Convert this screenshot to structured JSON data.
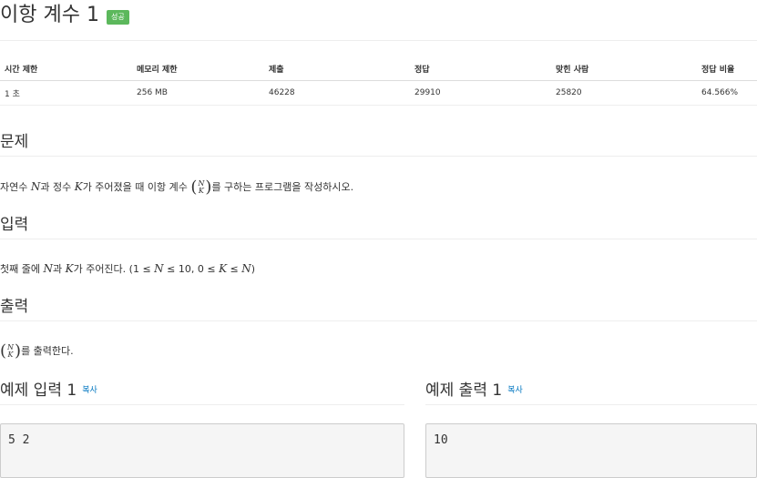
{
  "problem": {
    "title": "이항 계수 1",
    "status_badge": "성공"
  },
  "info_table": {
    "headers": [
      "시간 제한",
      "메모리 제한",
      "제출",
      "정답",
      "맞힌 사람",
      "정답 비율"
    ],
    "row": [
      "1 초",
      "256 MB",
      "46228",
      "29910",
      "25820",
      "64.566%"
    ]
  },
  "sections": {
    "problem_heading": "문제",
    "problem_text": {
      "p1": "자연수 ",
      "v1": "N",
      "p2": "과 정수 ",
      "v2": "K",
      "p3": "가 주어졌을 때 이항 계수 ",
      "binom_top": "N",
      "binom_bottom": "K",
      "p4": "를 구하는 프로그램을 작성하시오."
    },
    "input_heading": "입력",
    "input_text": {
      "p1": "첫째 줄에 ",
      "v1": "N",
      "p2": "과 ",
      "v2": "K",
      "p3": "가 주어진다. (1 ≤ ",
      "v3": "N",
      "p4": " ≤ 10, 0 ≤ ",
      "v4": "K",
      "p5": " ≤ ",
      "v5": "N",
      "p6": ")"
    },
    "output_heading": "출력",
    "output_text": {
      "binom_top": "N",
      "binom_bottom": "K",
      "p1": "를 출력한다."
    }
  },
  "examples": {
    "input": {
      "heading": "예제 입력 1",
      "copy_label": "복사",
      "content": "5 2"
    },
    "output": {
      "heading": "예제 출력 1",
      "copy_label": "복사",
      "content": "10"
    }
  },
  "colors": {
    "badge": "#5cb85c",
    "accent_link": "#0076c0",
    "code_bg": "#f5f5f5"
  }
}
